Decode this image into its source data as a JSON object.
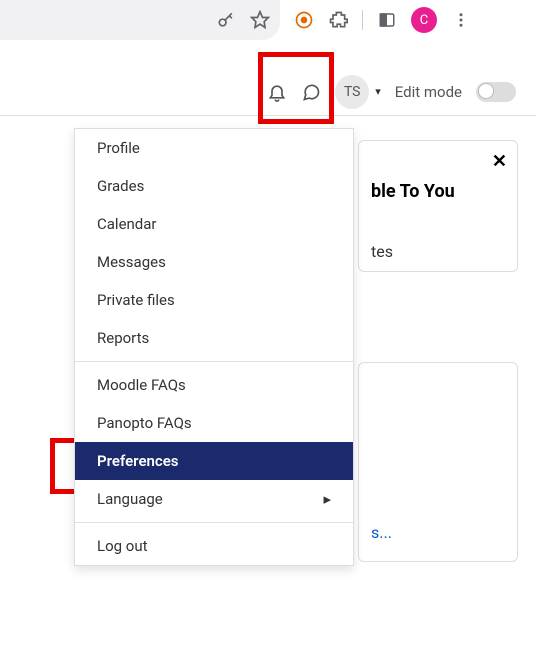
{
  "browser": {
    "profile_letter": "C"
  },
  "pagebar": {
    "avatar_initials": "TS",
    "edit_mode_label": "Edit mode"
  },
  "dropdown": {
    "items": {
      "profile": "Profile",
      "grades": "Grades",
      "calendar": "Calendar",
      "messages": "Messages",
      "private_files": "Private files",
      "reports": "Reports",
      "moodle_faqs": "Moodle FAQs",
      "panopto_faqs": "Panopto FAQs",
      "preferences": "Preferences",
      "language": "Language",
      "logout": "Log out"
    }
  },
  "background": {
    "title_fragment": "ble To You",
    "text_fragment": "tes",
    "link_fragment": "s..."
  }
}
